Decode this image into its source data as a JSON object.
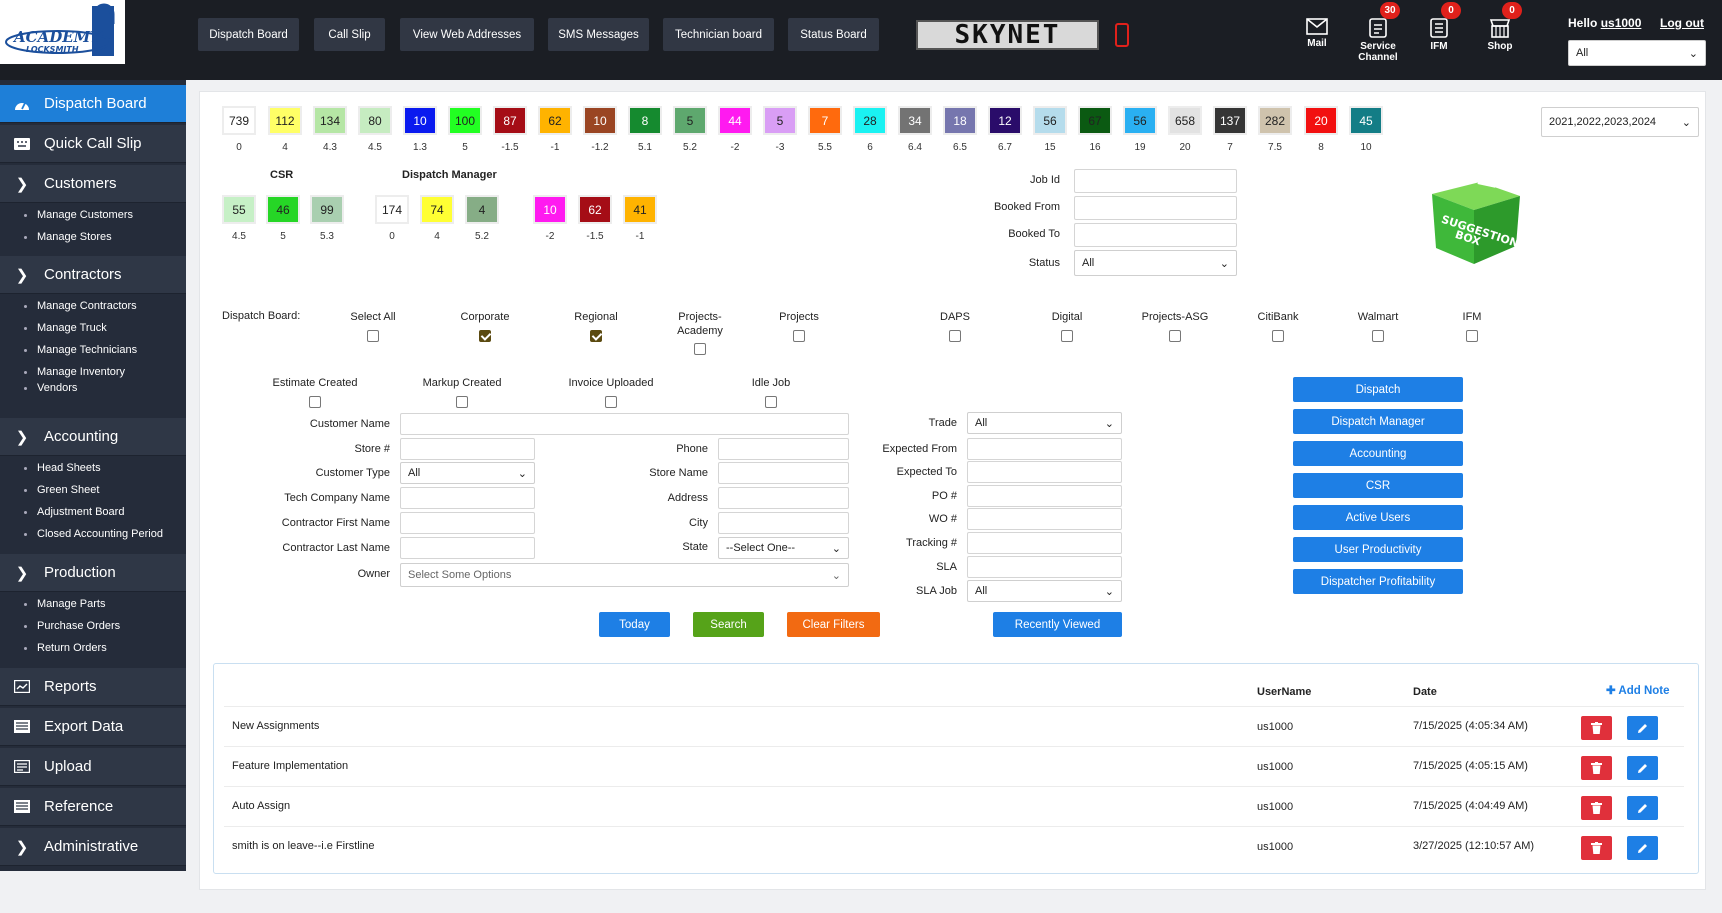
{
  "app": {
    "logo_text": "ACADEMY LOCKSMITH",
    "brand": "SKYNET"
  },
  "topnav": {
    "buttons": [
      "Dispatch Board",
      "Call Slip",
      "View Web Addresses",
      "SMS Messages",
      "Technician board",
      "Status Board"
    ]
  },
  "topicons": [
    {
      "label": "Mail",
      "icon": "mail-icon",
      "badge": ""
    },
    {
      "label": "Service Channel",
      "icon": "document-icon",
      "badge": "30"
    },
    {
      "label": "IFM",
      "icon": "list-icon",
      "badge": "0"
    },
    {
      "label": "Shop",
      "icon": "shop-icon",
      "badge": "0"
    }
  ],
  "user": {
    "hello": "Hello",
    "username": "us1000",
    "logout": "Log out",
    "scope_value": "All"
  },
  "sidebar": {
    "items": [
      {
        "label": "Dispatch Board",
        "icon": "dashboard-icon"
      },
      {
        "label": "Quick Call Slip",
        "icon": "keyboard-icon"
      },
      {
        "label": "Customers",
        "icon": "chevron-right-icon"
      },
      {
        "label": "Contractors",
        "icon": "chevron-right-icon"
      },
      {
        "label": "Accounting",
        "icon": "chevron-right-icon"
      },
      {
        "label": "Production",
        "icon": "chevron-right-icon"
      },
      {
        "label": "Reports",
        "icon": "report-icon"
      },
      {
        "label": "Export Data",
        "icon": "export-icon"
      },
      {
        "label": "Upload",
        "icon": "upload-icon"
      },
      {
        "label": "Reference",
        "icon": "reference-icon"
      },
      {
        "label": "Administrative",
        "icon": "chevron-right-icon"
      }
    ],
    "customers_sub": [
      "Manage Customers",
      "Manage Stores"
    ],
    "contractors_sub": [
      "Manage Contractors",
      "Manage Truck",
      "Manage Technicians",
      "Manage Inventory",
      "Vendors"
    ],
    "accounting_sub": [
      "Head Sheets",
      "Green Sheet",
      "Adjustment Board",
      "Closed Accounting Period"
    ],
    "production_sub": [
      "Manage Parts",
      "Purchase Orders",
      "Return Orders"
    ]
  },
  "counters": [
    {
      "value": "739",
      "sub": "0",
      "bg": "#ffffff",
      "fg": "#222"
    },
    {
      "value": "112",
      "sub": "4",
      "bg": "#ffff66",
      "fg": "#222"
    },
    {
      "value": "134",
      "sub": "4.3",
      "bg": "#b5e6a5",
      "fg": "#222"
    },
    {
      "value": "80",
      "sub": "4.5",
      "bg": "#c6ecc1",
      "fg": "#222"
    },
    {
      "value": "10",
      "sub": "1.3",
      "bg": "#0a1aef",
      "fg": "#fff"
    },
    {
      "value": "100",
      "sub": "5",
      "bg": "#22ff22",
      "fg": "#222"
    },
    {
      "value": "87",
      "sub": "-1.5",
      "bg": "#a50d16",
      "fg": "#fff"
    },
    {
      "value": "62",
      "sub": "-1",
      "bg": "#ffb300",
      "fg": "#222"
    },
    {
      "value": "10",
      "sub": "-1.2",
      "bg": "#9a4523",
      "fg": "#fff"
    },
    {
      "value": "8",
      "sub": "5.1",
      "bg": "#158a2f",
      "fg": "#fff"
    },
    {
      "value": "5",
      "sub": "5.2",
      "bg": "#5ea86e",
      "fg": "#222"
    },
    {
      "value": "44",
      "sub": "-2",
      "bg": "#ff1af0",
      "fg": "#fff"
    },
    {
      "value": "5",
      "sub": "-3",
      "bg": "#d99ef5",
      "fg": "#222"
    },
    {
      "value": "7",
      "sub": "5.5",
      "bg": "#ff6a0d",
      "fg": "#fff"
    },
    {
      "value": "28",
      "sub": "6",
      "bg": "#1af2f2",
      "fg": "#222"
    },
    {
      "value": "34",
      "sub": "6.4",
      "bg": "#737373",
      "fg": "#fff"
    },
    {
      "value": "18",
      "sub": "6.5",
      "bg": "#7676ae",
      "fg": "#fff"
    },
    {
      "value": "12",
      "sub": "6.7",
      "bg": "#2a0c6a",
      "fg": "#fff"
    },
    {
      "value": "56",
      "sub": "15",
      "bg": "#b5dcec",
      "fg": "#222"
    },
    {
      "value": "67",
      "sub": "16",
      "bg": "#0b5a12",
      "fg": "#222"
    },
    {
      "value": "56",
      "sub": "19",
      "bg": "#2ab0f2",
      "fg": "#222"
    },
    {
      "value": "658",
      "sub": "20",
      "bg": "#e2e2e2",
      "fg": "#222"
    },
    {
      "value": "137",
      "sub": "7",
      "bg": "#353535",
      "fg": "#fff"
    },
    {
      "value": "282",
      "sub": "7.5",
      "bg": "#cfc3ad",
      "fg": "#222"
    },
    {
      "value": "20",
      "sub": "8",
      "bg": "#f21010",
      "fg": "#fff"
    },
    {
      "value": "45",
      "sub": "10",
      "bg": "#137d86",
      "fg": "#fff"
    }
  ],
  "year_select": "2021,2022,2023,2024",
  "csr": {
    "title": "CSR",
    "boxes": [
      {
        "value": "55",
        "sub": "4.5",
        "bg": "#c6f0c6",
        "fg": "#222"
      },
      {
        "value": "46",
        "sub": "5",
        "bg": "#26d626",
        "fg": "#222"
      },
      {
        "value": "99",
        "sub": "5.3",
        "bg": "#a9cfb0",
        "fg": "#222"
      }
    ]
  },
  "dm": {
    "title": "Dispatch Manager",
    "boxes": [
      {
        "value": "174",
        "sub": "0",
        "bg": "#ffffff",
        "fg": "#222"
      },
      {
        "value": "74",
        "sub": "4",
        "bg": "#ffff33",
        "fg": "#222"
      },
      {
        "value": "4",
        "sub": "5.2",
        "bg": "#86ad86",
        "fg": "#222"
      },
      {
        "value": "10",
        "sub": "-2",
        "bg": "#ff1af0",
        "fg": "#fff"
      },
      {
        "value": "62",
        "sub": "-1.5",
        "bg": "#a50d16",
        "fg": "#fff"
      },
      {
        "value": "41",
        "sub": "-1",
        "bg": "#ffb300",
        "fg": "#222"
      }
    ]
  },
  "jobfields": {
    "job_id": "Job Id",
    "booked_from": "Booked From",
    "booked_to": "Booked To",
    "status": "Status",
    "status_value": "All"
  },
  "suggestion": {
    "text": "SUGGESTION BOX"
  },
  "board_filter": {
    "label": "Dispatch Board:",
    "options": [
      {
        "label": "Select All",
        "checked": false
      },
      {
        "label": "Corporate",
        "checked": true
      },
      {
        "label": "Regional",
        "checked": true
      },
      {
        "label": "Projects-Academy",
        "checked": false
      },
      {
        "label": "Projects",
        "checked": false
      },
      {
        "label": "DAPS",
        "checked": false
      },
      {
        "label": "Digital",
        "checked": false
      },
      {
        "label": "Projects-ASG",
        "checked": false
      },
      {
        "label": "CitiBank",
        "checked": false
      },
      {
        "label": "Walmart",
        "checked": false
      },
      {
        "label": "IFM",
        "checked": false
      }
    ]
  },
  "flags": [
    {
      "label": "Estimate Created",
      "checked": false
    },
    {
      "label": "Markup Created",
      "checked": false
    },
    {
      "label": "Invoice Uploaded",
      "checked": false
    },
    {
      "label": "Idle Job",
      "checked": false
    }
  ],
  "form": {
    "customer_name": "Customer Name",
    "store_no": "Store #",
    "customer_type": "Customer Type",
    "customer_type_value": "All",
    "tech_company": "Tech Company Name",
    "contractor_first": "Contractor First Name",
    "contractor_last": "Contractor Last Name",
    "owner": "Owner",
    "owner_placeholder": "Select Some Options",
    "phone": "Phone",
    "store_name": "Store Name",
    "address": "Address",
    "city": "City",
    "state": "State",
    "state_value": "--Select One--",
    "trade": "Trade",
    "trade_value": "All",
    "expected_from": "Expected From",
    "expected_to": "Expected To",
    "po": "PO #",
    "wo": "WO #",
    "tracking": "Tracking #",
    "sla": "SLA",
    "sla_job": "SLA Job",
    "sla_job_value": "All"
  },
  "actions": {
    "today": "Today",
    "search": "Search",
    "clear": "Clear Filters",
    "recent": "Recently Viewed"
  },
  "sidebuttons": [
    "Dispatch",
    "Dispatch Manager",
    "Accounting",
    "CSR",
    "Active Users",
    "User Productivity",
    "Dispatcher Profitability"
  ],
  "notes": {
    "col_user": "UserName",
    "col_date": "Date",
    "add_note": "Add Note",
    "rows": [
      {
        "title": "New Assignments",
        "user": "us1000",
        "date": "7/15/2025 (4:05:34 AM)"
      },
      {
        "title": "Feature Implementation",
        "user": "us1000",
        "date": "7/15/2025 (4:05:15 AM)"
      },
      {
        "title": "Auto Assign",
        "user": "us1000",
        "date": "7/15/2025 (4:04:49 AM)"
      },
      {
        "title": "smith is on leave--i.e Firstline",
        "user": "us1000",
        "date": "3/27/2025 (12:10:57 AM)"
      }
    ]
  }
}
